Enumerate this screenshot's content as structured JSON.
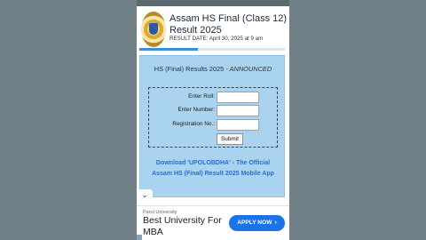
{
  "header": {
    "title": "Assam HS Final (Class 12) Result 2025",
    "result_date": "RESULT DATE: April 30, 2025 at 9 am",
    "progress_percent": 40
  },
  "card": {
    "title": "HS (Final) Results 2025",
    "title_status": "- ANNOUNCED",
    "form": {
      "roll_label": "Enter Roll:",
      "roll_value": "",
      "number_label": "Enter Number:",
      "number_value": "",
      "registration_label": "Registration No.:",
      "registration_value": "",
      "submit_label": "Submit"
    },
    "download_link": "Download 'UPOLOBDHA' - The Official Assam HS (Final) Result 2025 Mobile App"
  },
  "collapse_icon": "chevron-down-icon",
  "ad": {
    "source": "Parul University",
    "headline": "Best University For MBA",
    "cta_label": "APPLY NOW",
    "cta_color": "#1a73e8"
  },
  "colors": {
    "background": "#6f8087",
    "card_bg": "#a9d3ee",
    "link": "#2a6fcf"
  }
}
